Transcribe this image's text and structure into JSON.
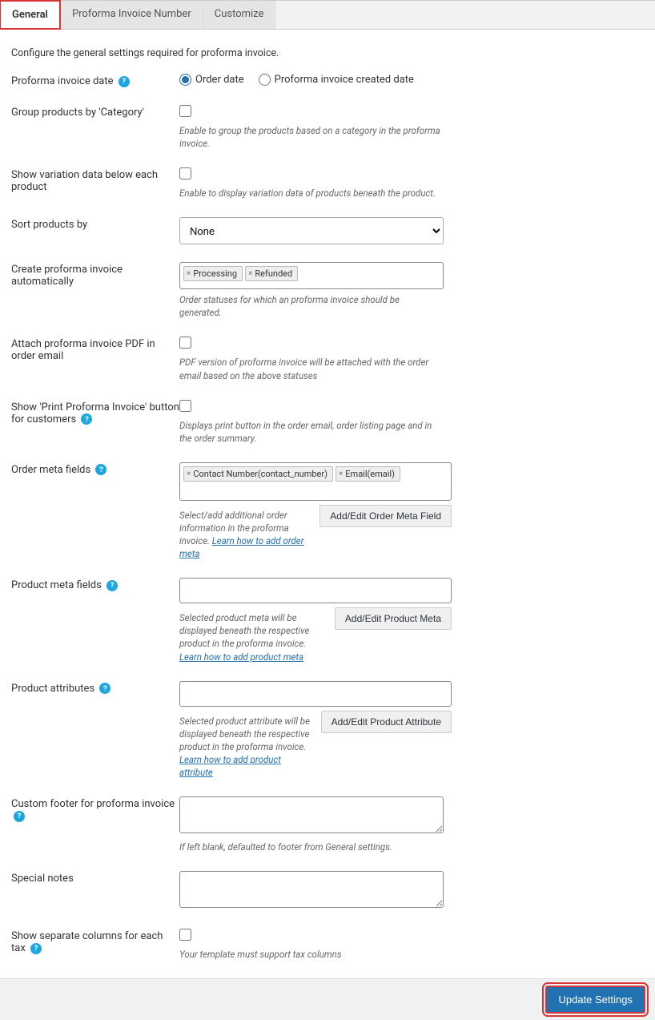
{
  "tabs": {
    "general": "General",
    "proforma_number": "Proforma Invoice Number",
    "customize": "Customize"
  },
  "intro": "Configure the general settings required for proforma invoice.",
  "fields": {
    "date": {
      "label": "Proforma invoice date",
      "opt_order_date": "Order date",
      "opt_created_date": "Proforma invoice created date"
    },
    "group_category": {
      "label": "Group products by 'Category'",
      "desc": "Enable to group the products based on a category in the proforma invoice."
    },
    "variation_data": {
      "label": "Show variation data below each product",
      "desc": "Enable to display variation data of products beneath the product."
    },
    "sort_by": {
      "label": "Sort products by",
      "value": "None"
    },
    "auto_invoice": {
      "label": "Create proforma invoice automatically",
      "tags": [
        "Processing",
        "Refunded"
      ],
      "desc": "Order statuses for which an proforma invoice should be generated."
    },
    "attach_pdf": {
      "label": "Attach proforma invoice PDF in order email",
      "desc": "PDF version of proforma invoice will be attached with the order email based on the above statuses"
    },
    "print_button": {
      "label": "Show 'Print Proforma Invoice' button for customers",
      "desc": "Displays print button in the order email, order listing page and in the order summary."
    },
    "order_meta": {
      "label": "Order meta fields",
      "tags": [
        "Contact Number(contact_number)",
        "Email(email)"
      ],
      "desc_prefix": "Select/add additional order information in the proforma invoice.",
      "link": "Learn how to add order meta",
      "button": "Add/Edit Order Meta Field"
    },
    "product_meta": {
      "label": "Product meta fields",
      "desc_prefix": "Selected product meta will be displayed beneath the respective product in the proforma invoice.",
      "link": "Learn how to add product meta",
      "button": "Add/Edit Product Meta"
    },
    "product_attr": {
      "label": "Product attributes",
      "desc_prefix": "Selected product attribute will be displayed beneath the respective product in the proforma invoice.",
      "link": "Learn how to add product attribute",
      "button": "Add/Edit Product Attribute"
    },
    "custom_footer": {
      "label": "Custom footer for proforma invoice",
      "desc": "If left blank, defaulted to footer from General settings."
    },
    "special_notes": {
      "label": "Special notes"
    },
    "separate_tax": {
      "label": "Show separate columns for each tax",
      "desc": "Your template must support tax columns"
    }
  },
  "footer": {
    "update": "Update Settings"
  }
}
